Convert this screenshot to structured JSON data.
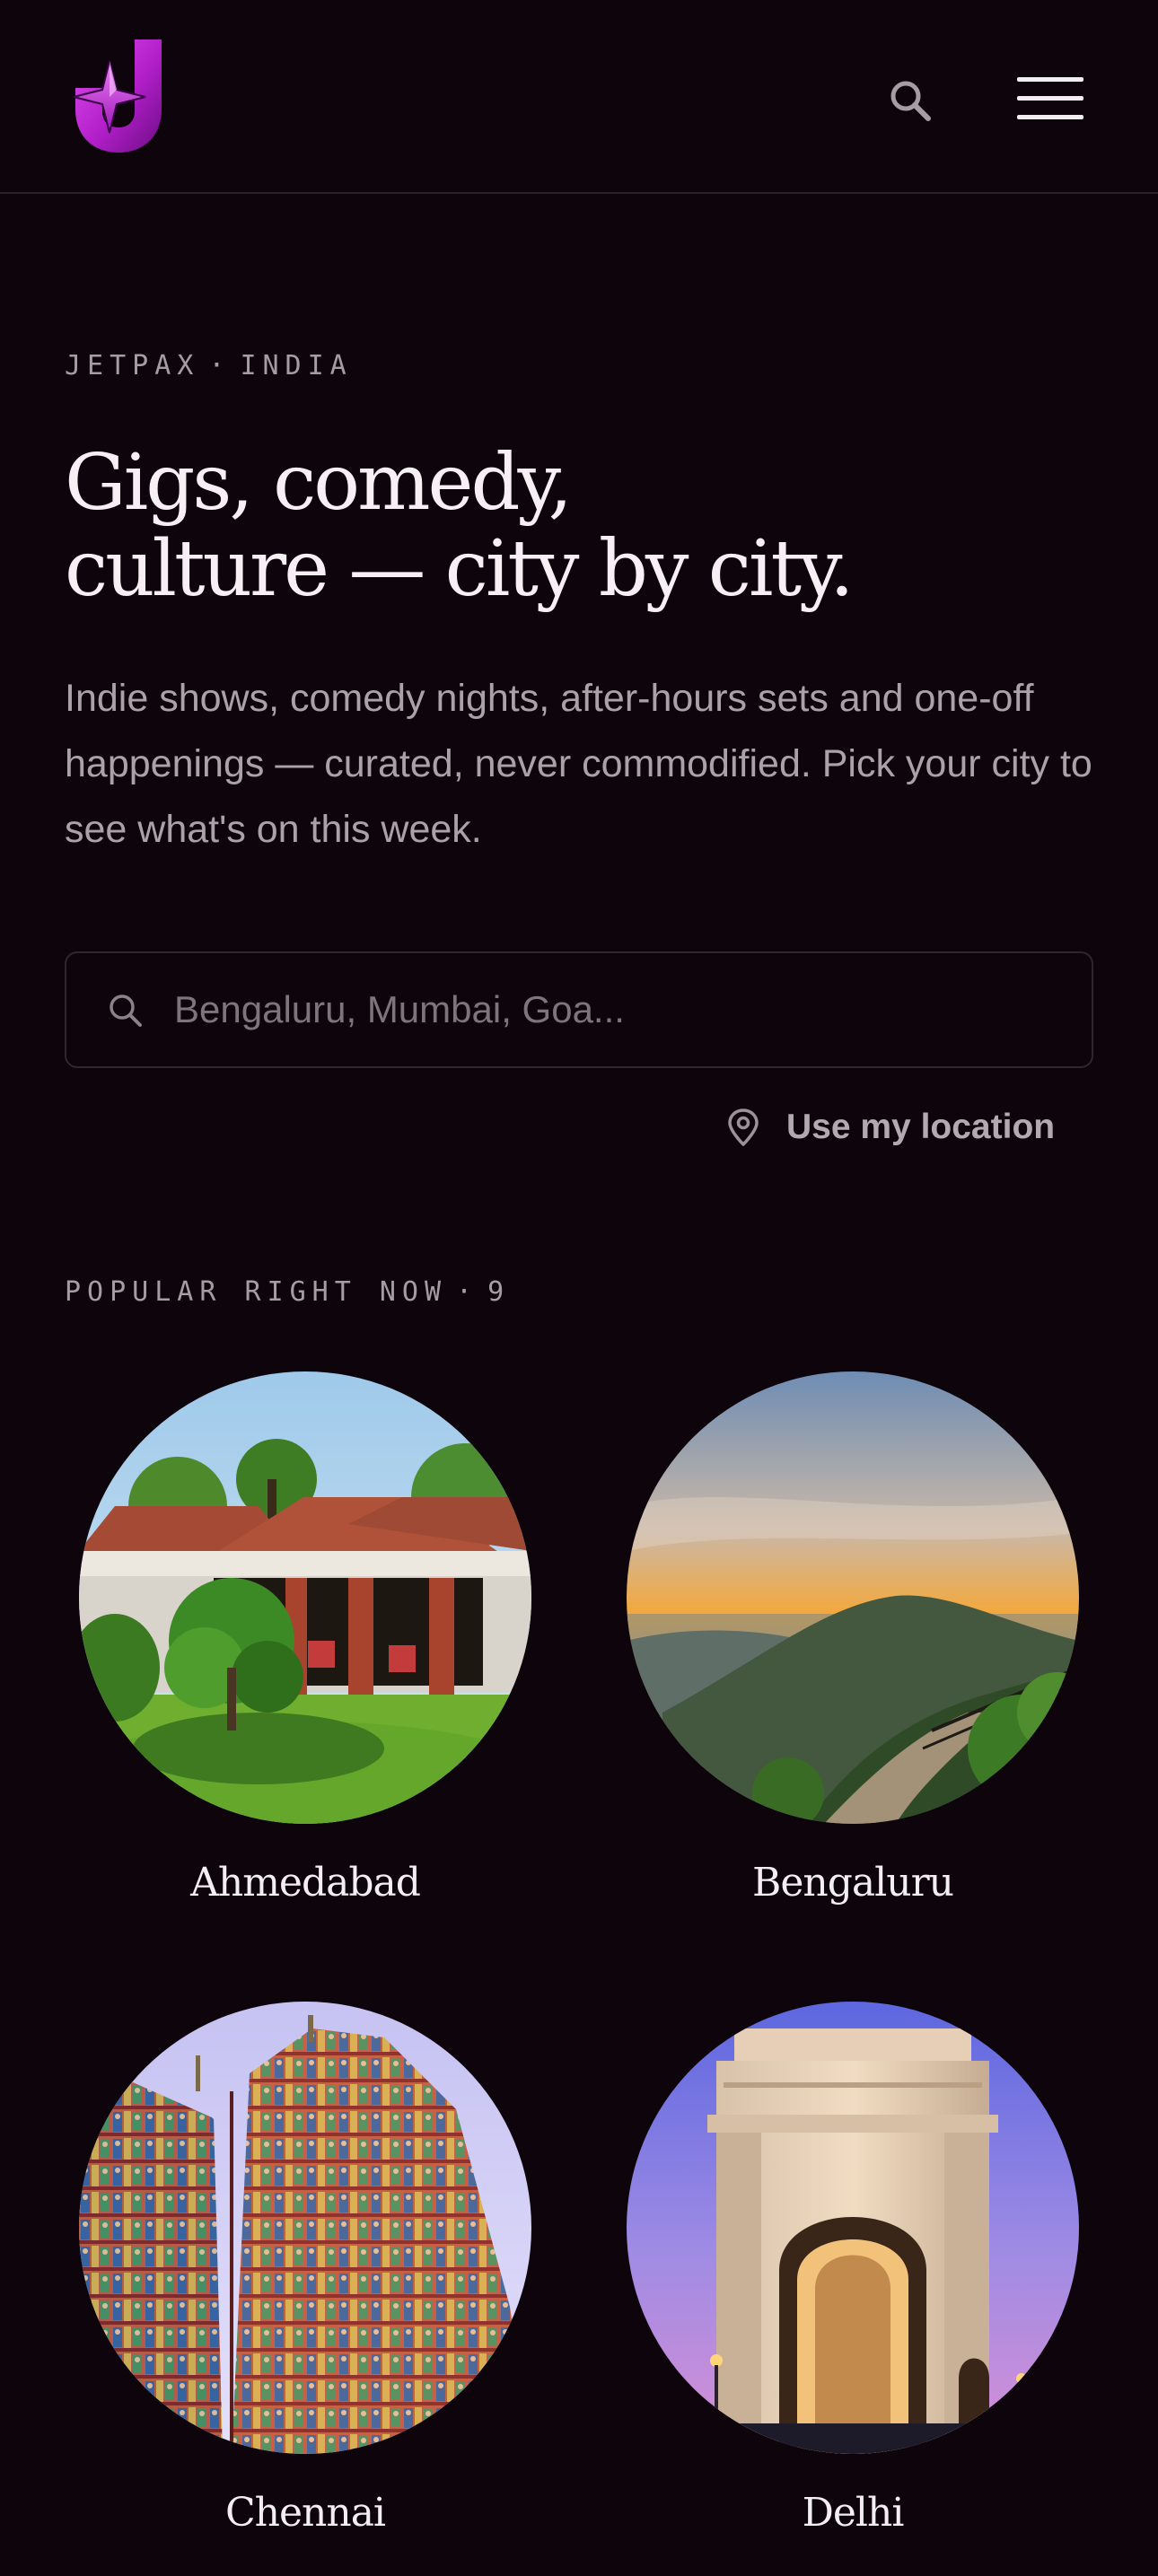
{
  "header": {
    "logo_icon": "jetpax-logo-icon",
    "search_icon": "search-icon",
    "menu_icon": "hamburger-menu-icon",
    "accent_color": "#b82bd1"
  },
  "hero": {
    "eyebrow_brand": "JETPAX",
    "eyebrow_separator": "·",
    "eyebrow_region": "INDIA",
    "headline_line1": "Gigs, comedy,",
    "headline_line2": "culture — city by city.",
    "subtitle": "Indie shows, comedy nights, after-hours sets and one-off happenings — curated, never commodified. Pick your city to see what's on this week."
  },
  "city_search": {
    "placeholder": "Bengaluru, Mumbai, Goa...",
    "value": "",
    "icon": "search-icon"
  },
  "location": {
    "label": "Use my location",
    "icon": "location-pin-icon"
  },
  "popular": {
    "label": "POPULAR RIGHT NOW",
    "separator": "·",
    "count": "9",
    "cities": [
      {
        "name": "Ahmedabad",
        "image": "garden-pavilion-photo"
      },
      {
        "name": "Bengaluru",
        "image": "hill-sunset-photo"
      },
      {
        "name": "Chennai",
        "image": "temple-gopuram-photo"
      },
      {
        "name": "Delhi",
        "image": "india-gate-photo"
      }
    ]
  }
}
